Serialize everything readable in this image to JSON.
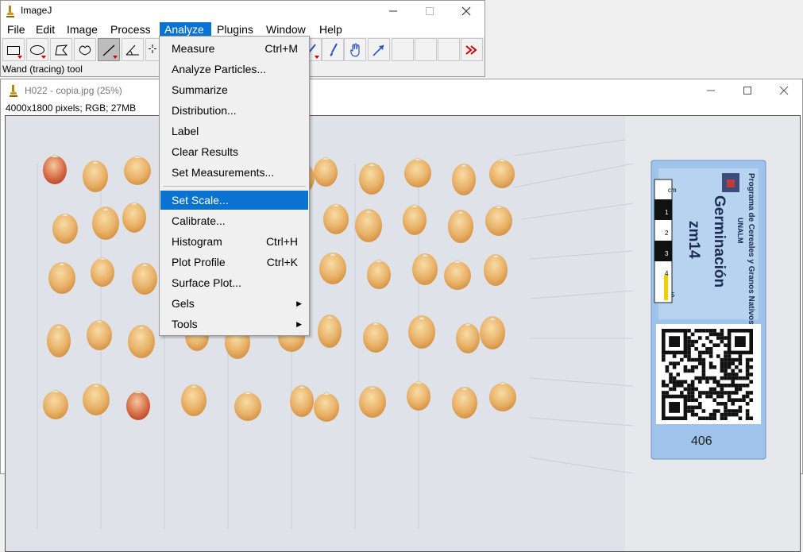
{
  "imagej_window": {
    "title": "ImageJ",
    "menus": [
      "File",
      "Edit",
      "Image",
      "Process",
      "Analyze",
      "Plugins",
      "Window",
      "Help"
    ],
    "active_menu": "Analyze",
    "toolbar_icons": [
      "rectangle-tool-icon",
      "oval-tool-icon",
      "polygon-tool-icon",
      "freehand-tool-icon",
      "straight-line-tool-icon",
      "angle-tool-icon",
      "point-tool-icon",
      "wand-tool-icon",
      "brush-tool-icon",
      "hand-tool-icon",
      "arrow-tool-icon",
      "more-tools-icon"
    ],
    "status_text": "Wand (tracing) tool"
  },
  "analyze_menu": {
    "items": [
      {
        "label": "Measure",
        "shortcut": "Ctrl+M"
      },
      {
        "label": "Analyze Particles...",
        "shortcut": ""
      },
      {
        "label": "Summarize",
        "shortcut": ""
      },
      {
        "label": "Distribution...",
        "shortcut": ""
      },
      {
        "label": "Label",
        "shortcut": ""
      },
      {
        "label": "Clear Results",
        "shortcut": ""
      },
      {
        "label": "Set Measurements...",
        "shortcut": ""
      },
      {
        "label": "Set Scale...",
        "shortcut": "",
        "highlighted": true
      },
      {
        "label": "Calibrate...",
        "shortcut": ""
      },
      {
        "label": "Histogram",
        "shortcut": "Ctrl+H"
      },
      {
        "label": "Plot Profile",
        "shortcut": "Ctrl+K"
      },
      {
        "label": "Surface Plot...",
        "shortcut": ""
      },
      {
        "label": "Gels",
        "shortcut": "",
        "submenu": true
      },
      {
        "label": "Tools",
        "shortcut": "",
        "submenu": true
      }
    ]
  },
  "image_window": {
    "title": "H022 - copia.jpg (25%)",
    "info": "4000x1800 pixels; RGB; 27MB"
  },
  "label_card": {
    "header": "Programa de Cereales y Granos Nativos",
    "org": "UNALM",
    "heading": "Germinación",
    "code": "zm14",
    "number": "406",
    "ruler_unit": "cm",
    "ruler_ticks": [
      "1",
      "2",
      "3",
      "4",
      "5"
    ]
  },
  "colors": {
    "accent": "#0a73d1",
    "menu_bg": "#f0f0f0",
    "card_blue": "#9fc3ea",
    "kernel": "#e9b269"
  }
}
